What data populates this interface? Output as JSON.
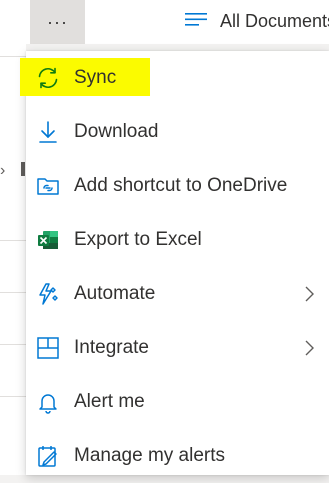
{
  "topbar": {
    "more_label": "···",
    "view_label": "All Documents"
  },
  "menu": {
    "items": [
      {
        "label": "Sync",
        "icon": "sync-icon",
        "highlighted": true
      },
      {
        "label": "Download",
        "icon": "download-icon"
      },
      {
        "label": "Add shortcut to OneDrive",
        "icon": "add-shortcut-icon"
      },
      {
        "label": "Export to Excel",
        "icon": "excel-icon"
      },
      {
        "label": "Automate",
        "icon": "automate-icon",
        "submenu": true
      },
      {
        "label": "Integrate",
        "icon": "integrate-icon",
        "submenu": true
      },
      {
        "label": "Alert me",
        "icon": "bell-icon"
      },
      {
        "label": "Manage my alerts",
        "icon": "manage-alerts-icon"
      }
    ]
  },
  "colors": {
    "accent": "#0078d4",
    "highlight": "#fbfb00",
    "excel": "#107c41"
  }
}
